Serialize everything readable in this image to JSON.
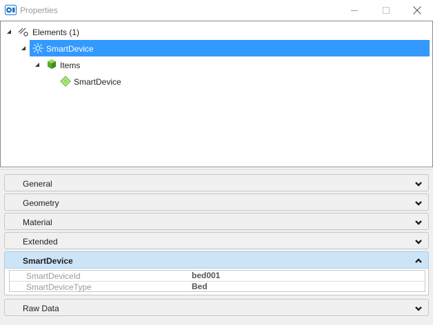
{
  "window": {
    "title": "Properties"
  },
  "tree": {
    "root": {
      "label": "Elements (1)"
    },
    "device": {
      "label": "SmartDevice"
    },
    "items": {
      "label": "Items"
    },
    "item_child": {
      "label": "SmartDevice"
    }
  },
  "sections": [
    {
      "label": "General"
    },
    {
      "label": "Geometry"
    },
    {
      "label": "Material"
    },
    {
      "label": "Extended"
    },
    {
      "label": "SmartDevice"
    },
    {
      "label": "Raw Data"
    }
  ],
  "smartdevice_props": [
    {
      "name": "SmartDeviceId",
      "value": "bed001"
    },
    {
      "name": "SmartDeviceType",
      "value": "Bed"
    }
  ],
  "colors": {
    "selection": "#3399ff",
    "active_section": "#cce4f7",
    "panel_background": "#f0f0f0"
  }
}
